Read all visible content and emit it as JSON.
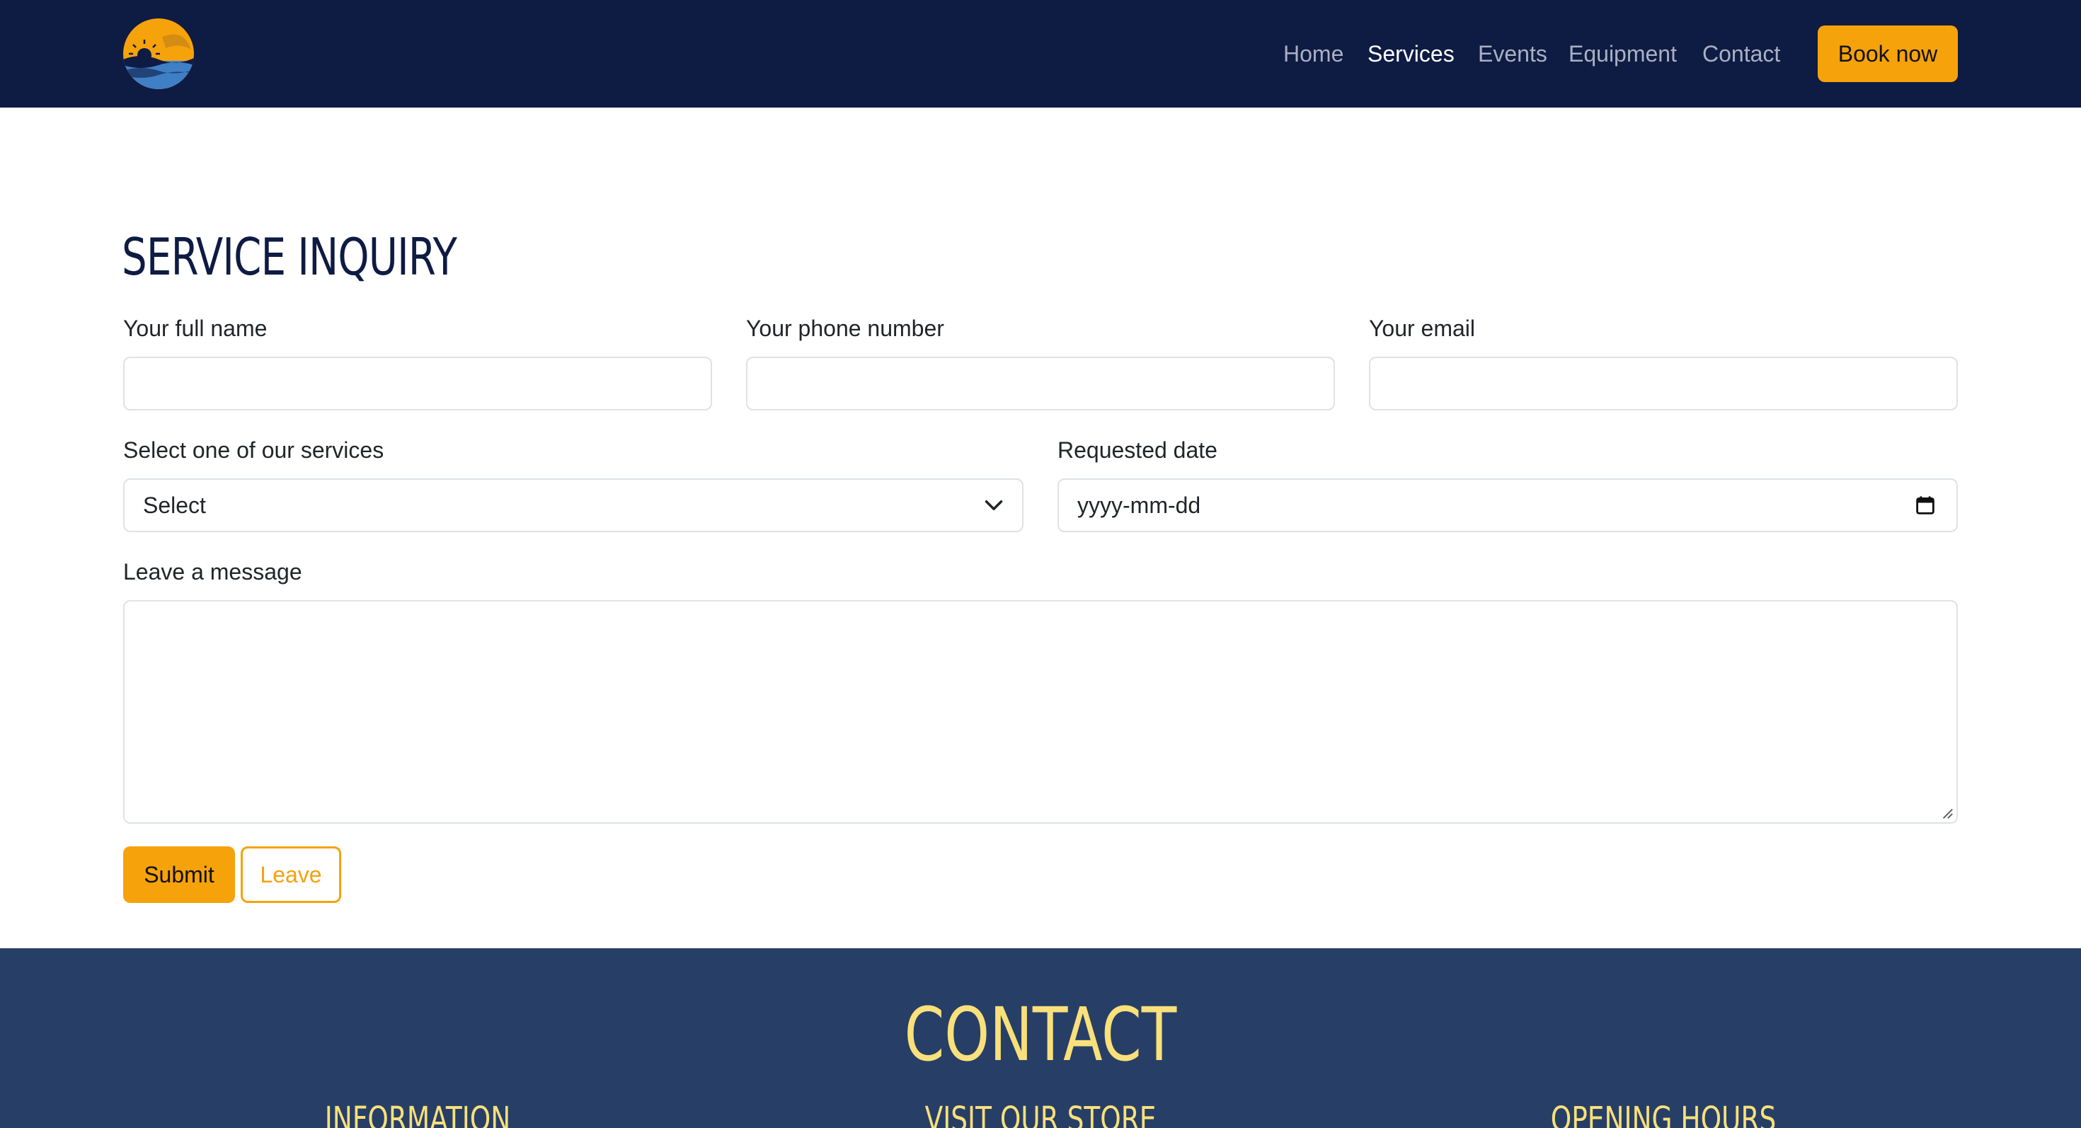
{
  "nav": {
    "logo_icon": "sun-over-waves-logo",
    "links": [
      {
        "label": "Home",
        "active": false
      },
      {
        "label": "Services",
        "active": true
      },
      {
        "label": "Events",
        "active": false
      },
      {
        "label": "Equipment",
        "active": false
      },
      {
        "label": "Contact",
        "active": false
      }
    ],
    "book_label": "Book now"
  },
  "form": {
    "title": "SERVICE INQUIRY",
    "name_label": "Your full name",
    "phone_label": "Your phone number",
    "email_label": "Your email",
    "service_label": "Select one of our services",
    "service_value": "Select",
    "date_label": "Requested date",
    "date_placeholder": "yyyy-mm-dd",
    "message_label": "Leave a message",
    "submit_label": "Submit",
    "leave_label": "Leave"
  },
  "contact": {
    "title": "CONTACT",
    "columns": [
      "INFORMATION",
      "VISIT OUR STORE",
      "OPENING HOURS"
    ]
  },
  "colors": {
    "navbar_bg": "#0e1b43",
    "accent": "#f6a20b",
    "contact_bg": "#273f67",
    "contact_text": "#f9e07a"
  }
}
